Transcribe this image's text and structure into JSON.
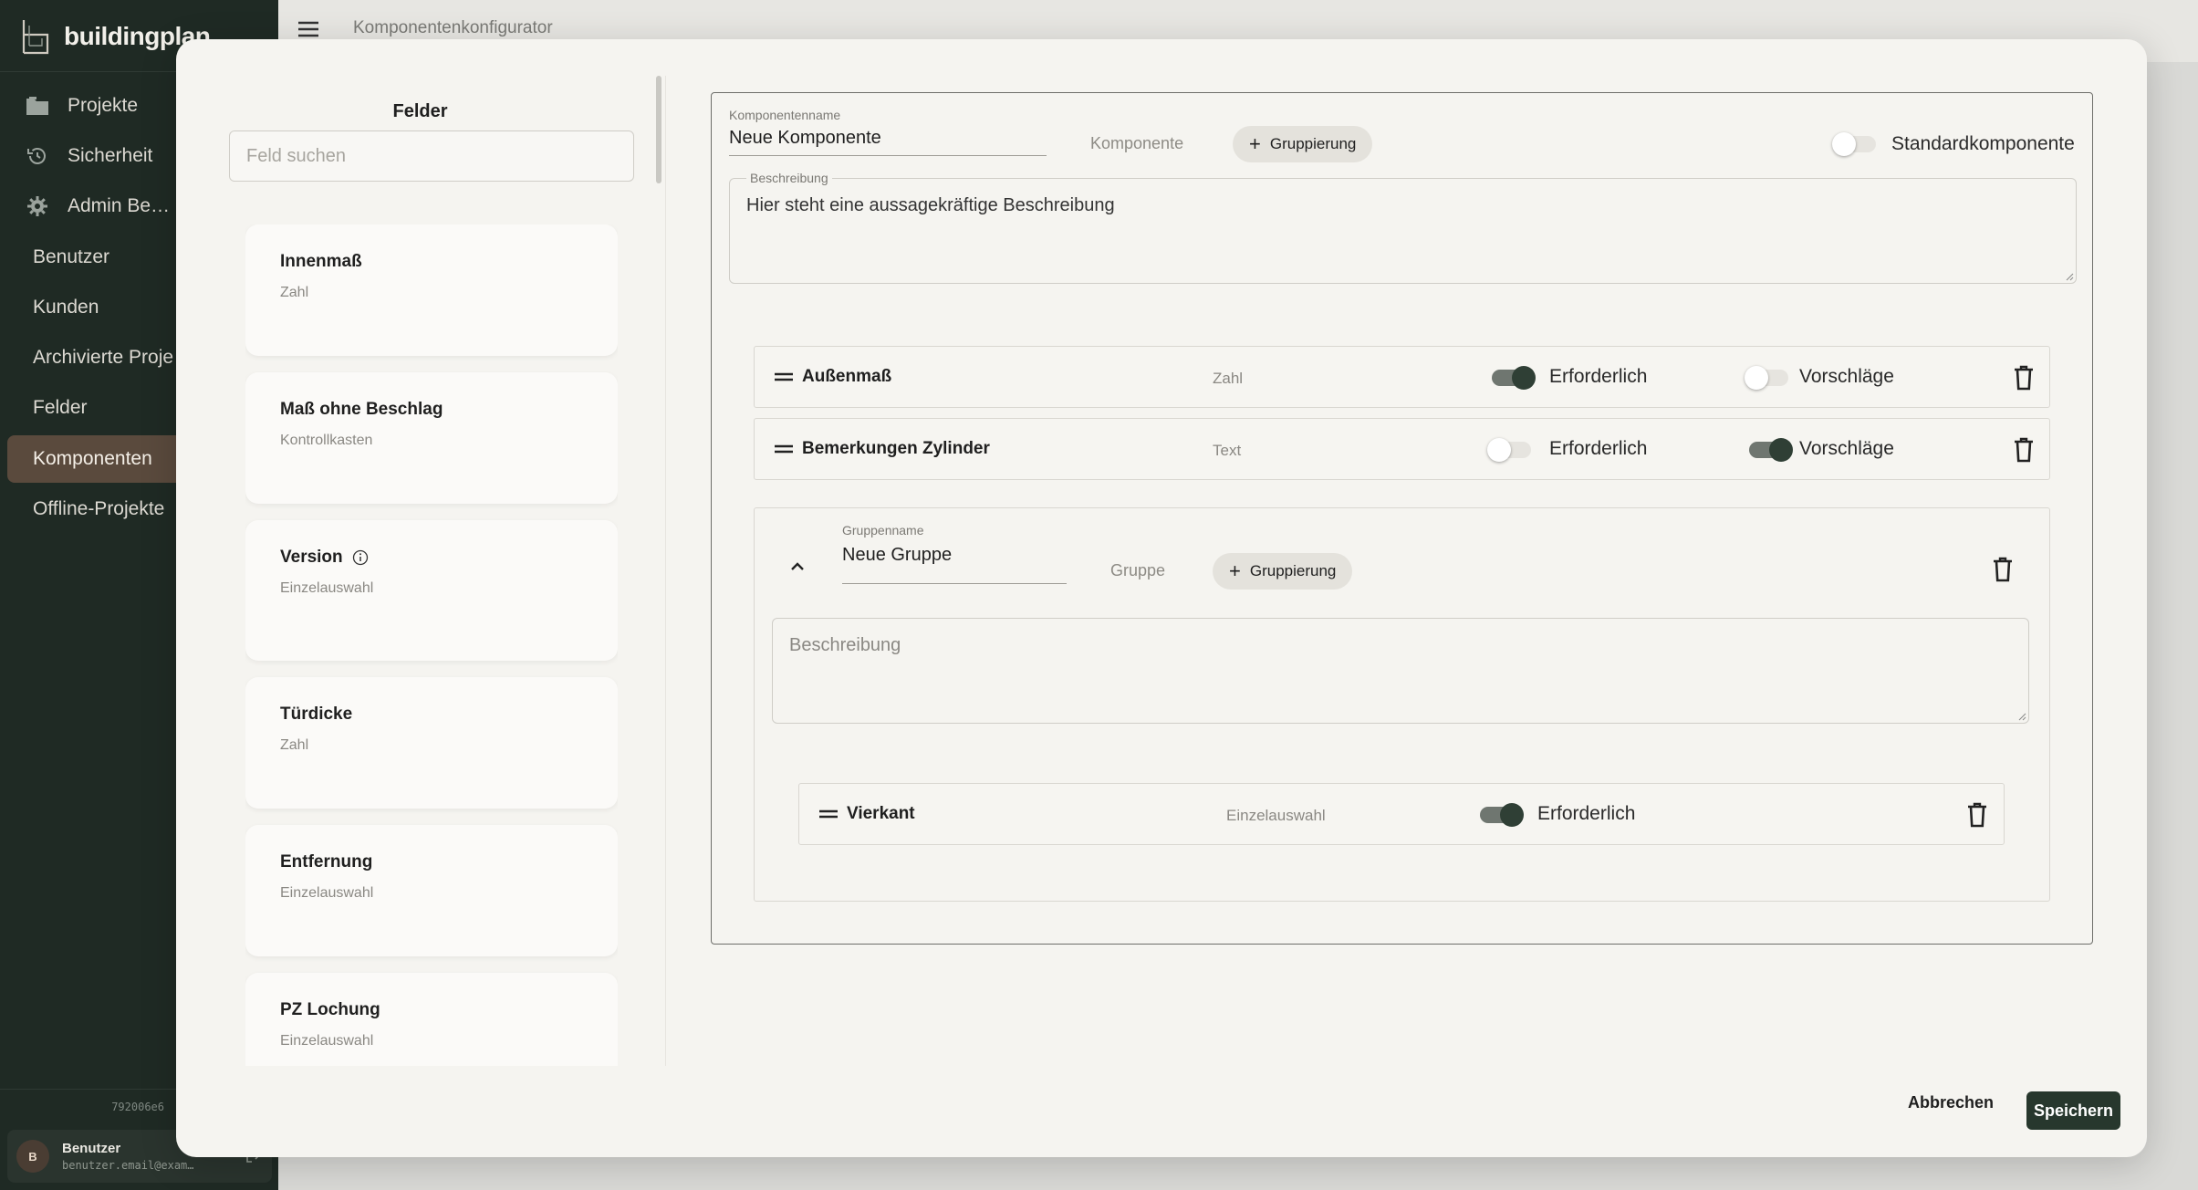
{
  "app": {
    "brand": "buildingplan",
    "page_title": "Komponentenkonfigurator",
    "version": "792006e6"
  },
  "sidebar": {
    "items": [
      {
        "label": "Projekte",
        "icon": "folder-icon"
      },
      {
        "label": "Sicherheit",
        "icon": "history-icon"
      },
      {
        "label": "Admin Be…",
        "icon": "gear-icon"
      },
      {
        "label": "Benutzer"
      },
      {
        "label": "Kunden"
      },
      {
        "label": "Archivierte Proje"
      },
      {
        "label": "Felder"
      },
      {
        "label": "Komponenten",
        "active": true
      },
      {
        "label": "Offline-Projekte"
      }
    ],
    "user": {
      "initial": "B",
      "name": "Benutzer",
      "email": "benutzer.email@exam…"
    }
  },
  "fields_panel": {
    "title": "Felder",
    "search_placeholder": "Feld suchen",
    "cards": [
      {
        "name": "Innenmaß",
        "type": "Zahl"
      },
      {
        "name": "Maß ohne Beschlag",
        "type": "Kontrollkasten"
      },
      {
        "name": "Version",
        "type": "Einzelauswahl",
        "has_info": true
      },
      {
        "name": "Türdicke",
        "type": "Zahl"
      },
      {
        "name": "Entfernung",
        "type": "Einzelauswahl"
      },
      {
        "name": "PZ Lochung",
        "type": "Einzelauswahl"
      }
    ]
  },
  "component": {
    "name_label": "Komponentenname",
    "name_value": "Neue Komponente",
    "kind": "Komponente",
    "grouping_button": "Gruppierung",
    "standard_label": "Standardkomponente",
    "standard_on": false,
    "description_label": "Beschreibung",
    "description_value": "Hier steht eine aussagekräftige Beschreibung",
    "rows": [
      {
        "name": "Außenmaß",
        "type": "Zahl",
        "required_label": "Erforderlich",
        "required": true,
        "suggest_label": "Vorschläge",
        "suggest": false
      },
      {
        "name": "Bemerkungen Zylinder",
        "type": "Text",
        "required_label": "Erforderlich",
        "required": false,
        "suggest_label": "Vorschläge",
        "suggest": true
      }
    ],
    "group": {
      "name_label": "Gruppenname",
      "name_value": "Neue Gruppe",
      "kind": "Gruppe",
      "grouping_button": "Gruppierung",
      "description_placeholder": "Beschreibung",
      "rows": [
        {
          "name": "Vierkant",
          "type": "Einzelauswahl",
          "required_label": "Erforderlich",
          "required": true
        }
      ]
    }
  },
  "footer": {
    "cancel": "Abbrechen",
    "save": "Speichern"
  },
  "colors": {
    "sidebar_bg": "#1f2a24",
    "active_nav": "#5a4a3d",
    "primary_button": "#27372d",
    "switch_on": "#2f3f35"
  }
}
